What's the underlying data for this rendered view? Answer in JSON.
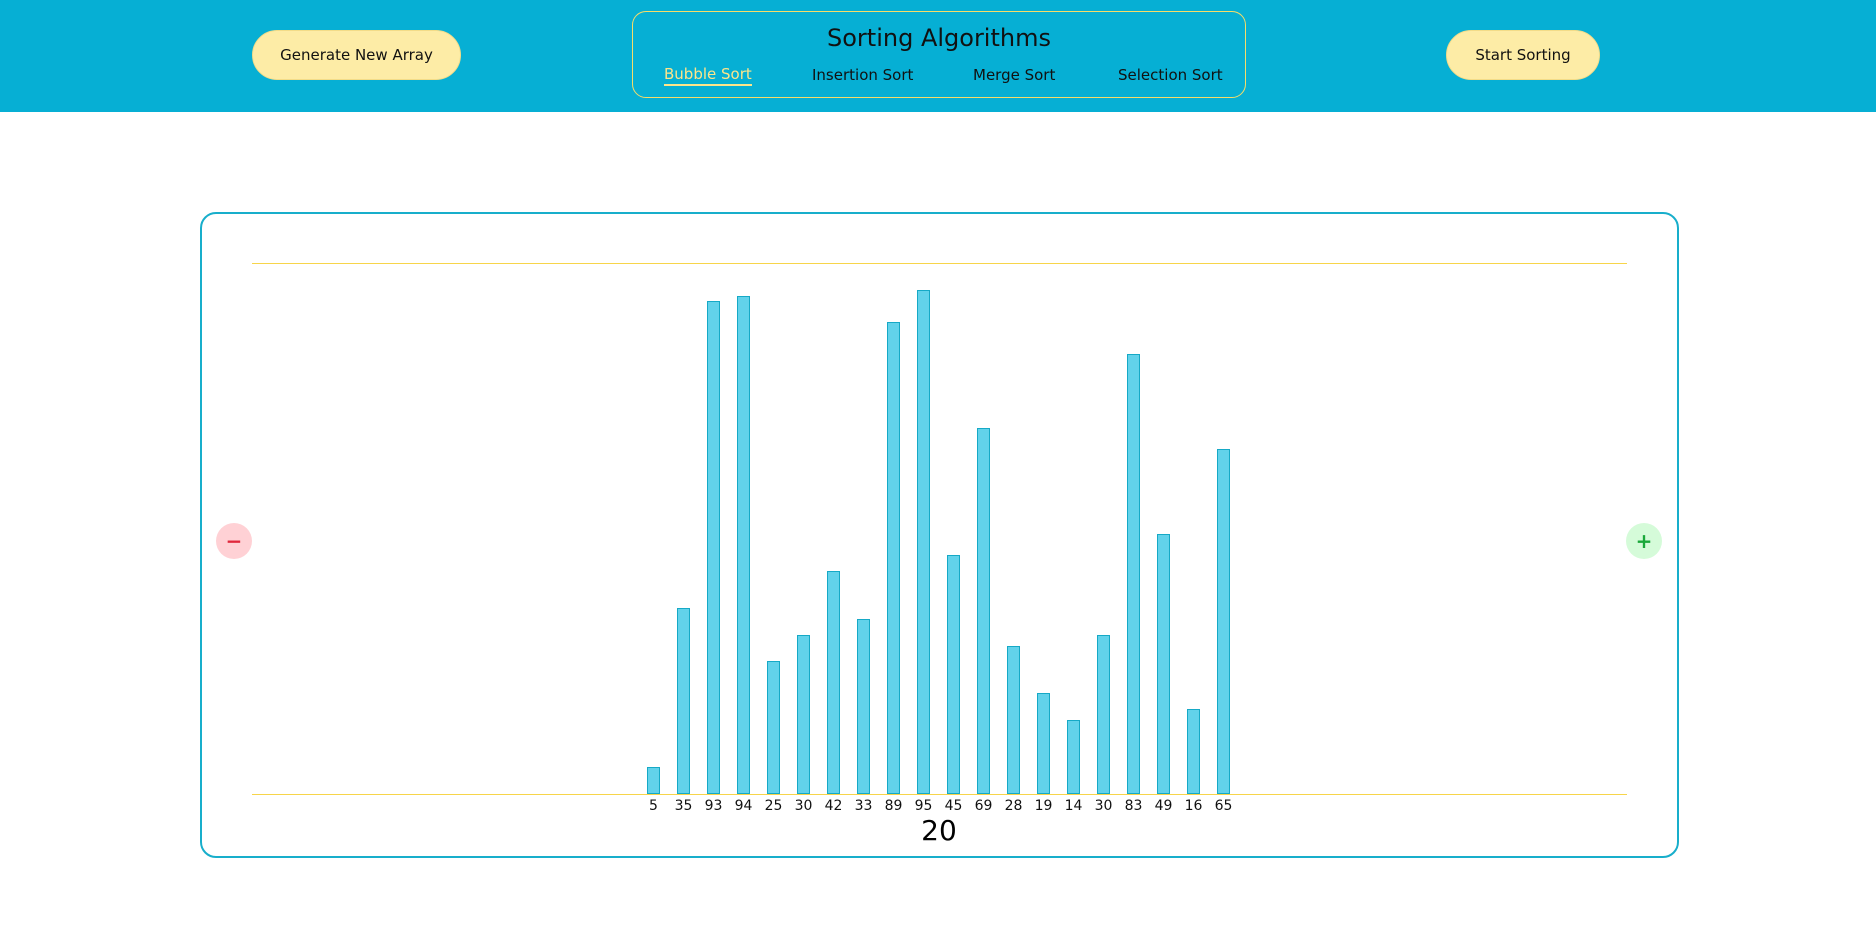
{
  "header": {
    "generate_label": "Generate New Array",
    "start_label": "Start Sorting",
    "title": "Sorting Algorithms",
    "tabs": [
      {
        "label": "Bubble Sort",
        "active": true
      },
      {
        "label": "Insertion Sort",
        "active": false
      },
      {
        "label": "Merge Sort",
        "active": false
      },
      {
        "label": "Selection Sort",
        "active": false
      }
    ]
  },
  "controls": {
    "decrease_symbol": "−",
    "increase_symbol": "+",
    "array_size": "20"
  },
  "colors": {
    "header_bg": "#06afd4",
    "button_bg": "#fdeca6",
    "bar_fill": "#62d2ea",
    "bar_stroke": "#16a9c6",
    "active_tab": "#fde58a",
    "guide_line": "#f7d54a",
    "minus_bg": "#ffd1d5",
    "plus_bg": "#d5fbd9"
  },
  "chart_data": {
    "type": "bar",
    "values": [
      5,
      35,
      93,
      94,
      25,
      30,
      42,
      33,
      89,
      95,
      45,
      69,
      28,
      19,
      14,
      30,
      83,
      49,
      16,
      65
    ],
    "ylim": [
      0,
      100
    ]
  }
}
